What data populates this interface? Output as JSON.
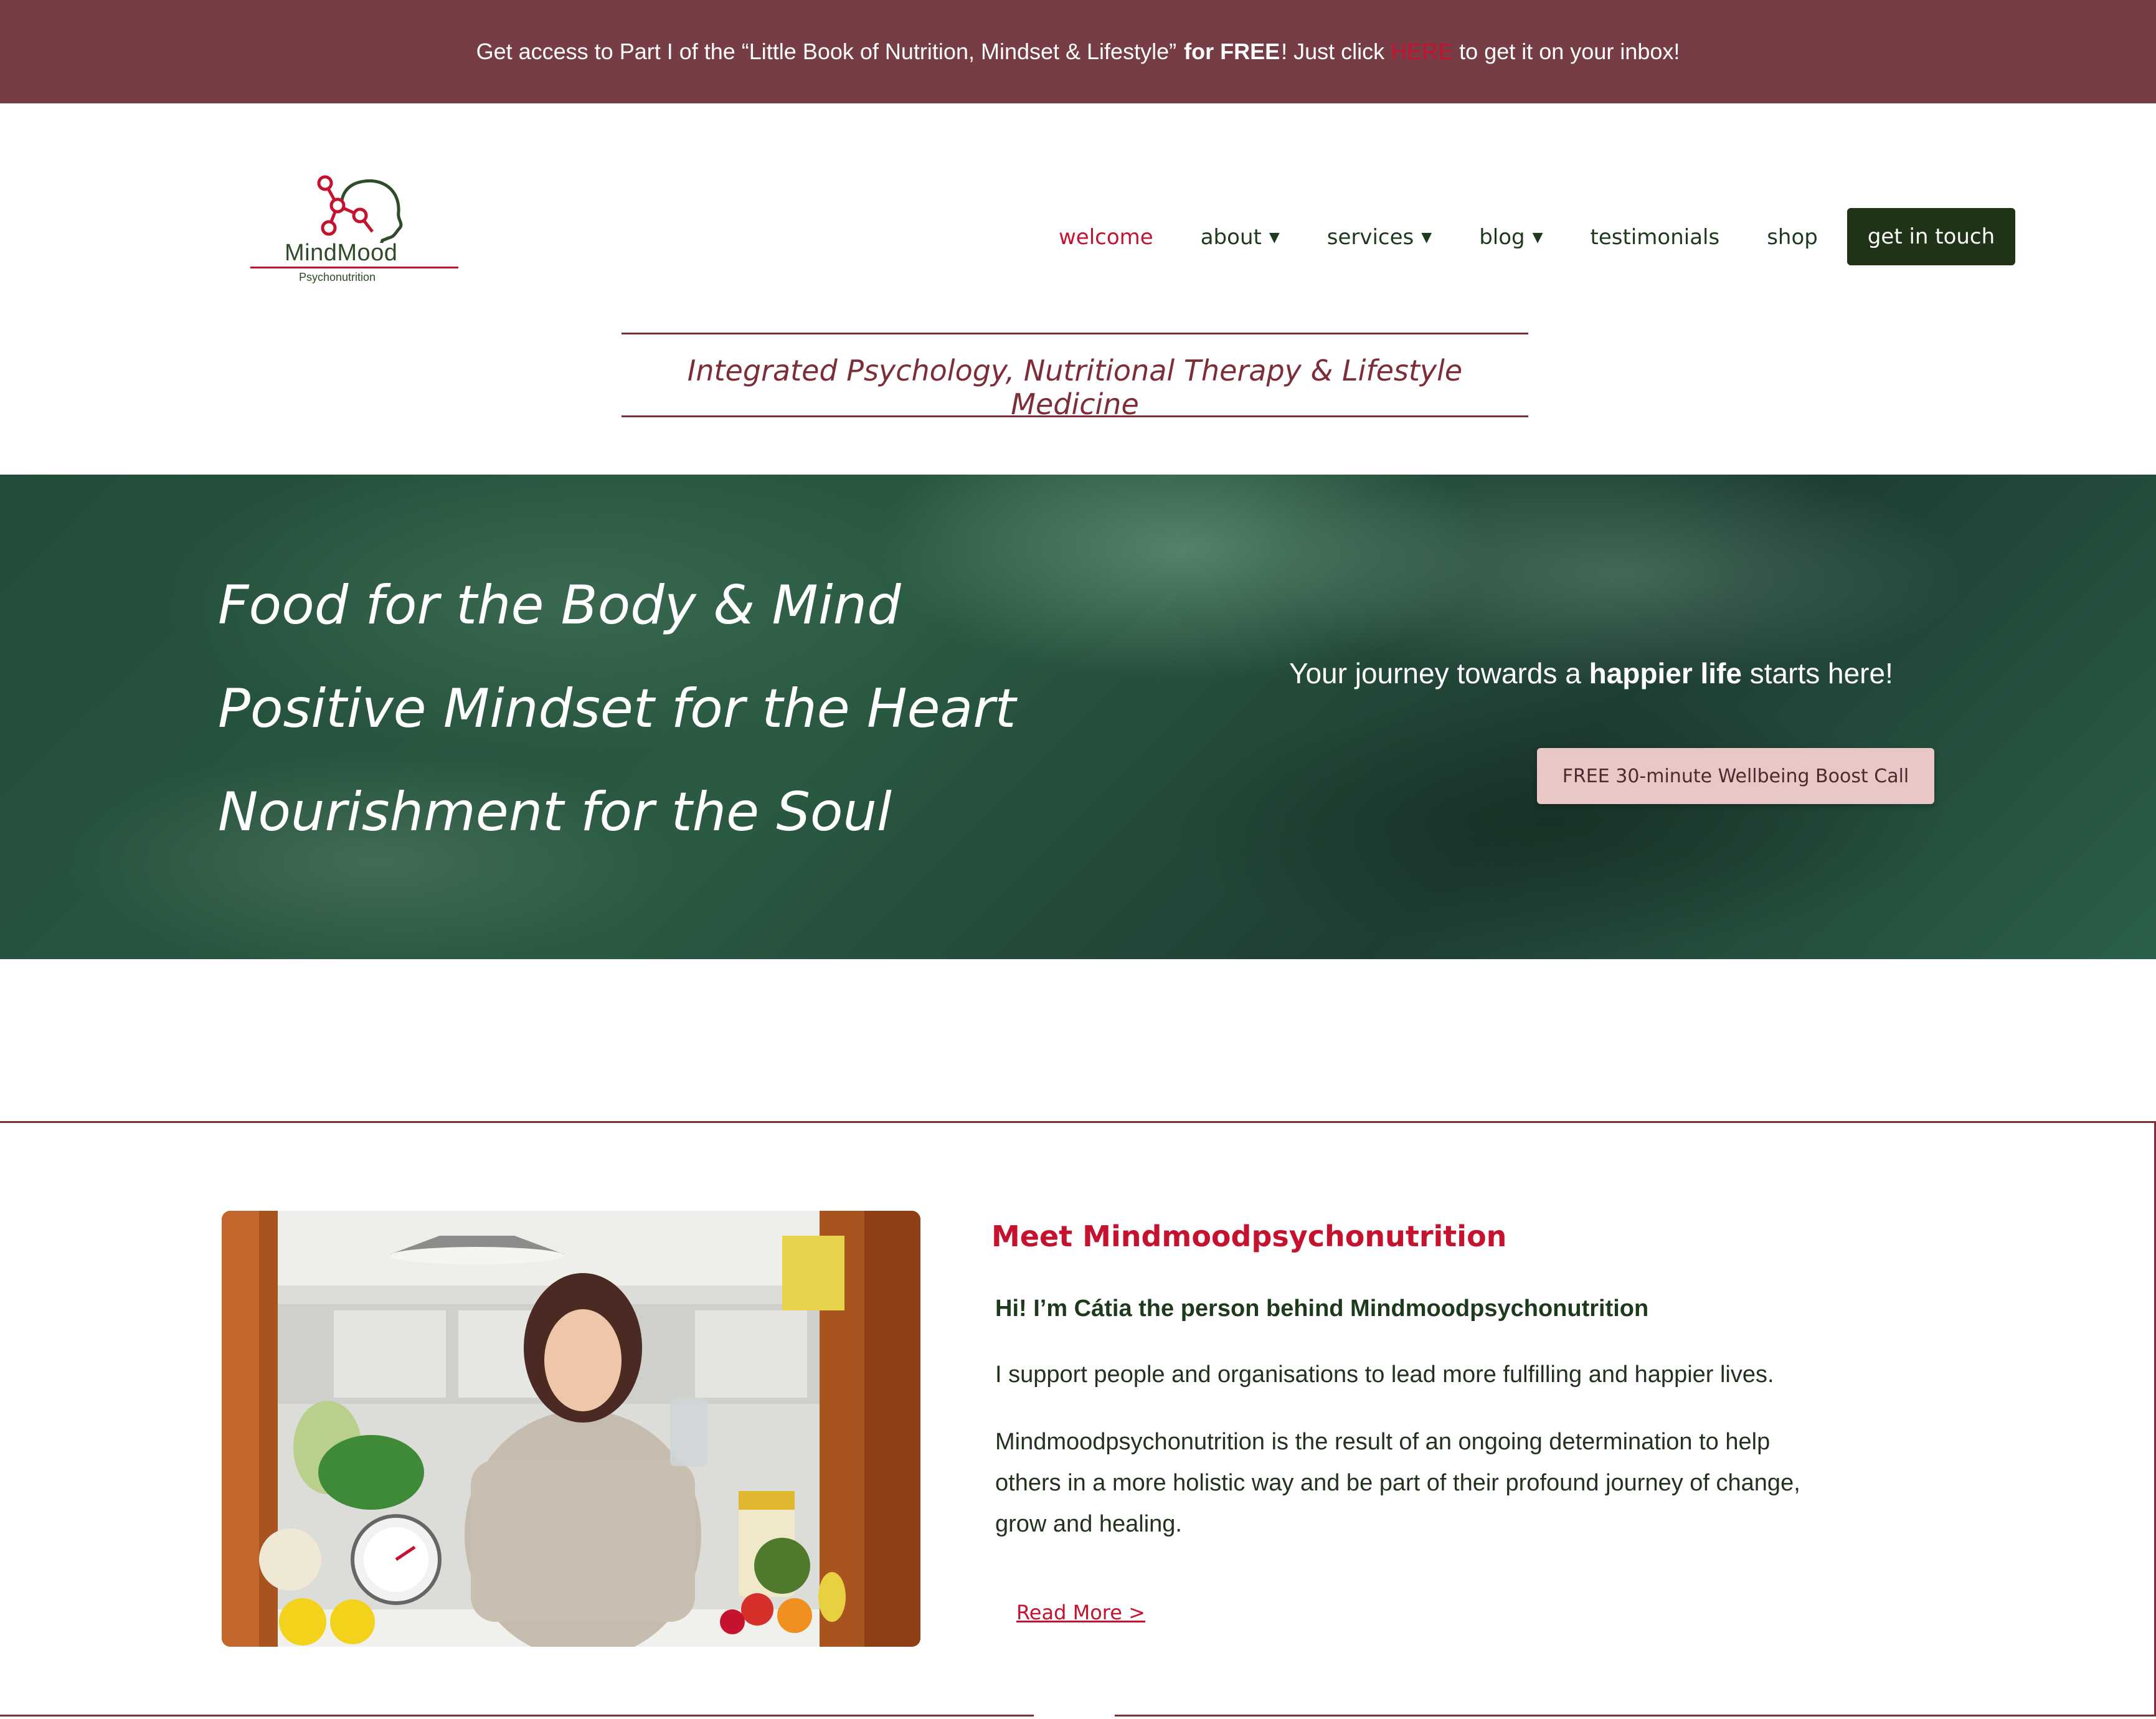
{
  "announcement": {
    "pre": "Get access to Part I of the “Little Book of Nutrition, Mindset & Lifestyle” ",
    "bold": "for FREE",
    "mid": "! Just click",
    "link": "HERE",
    "post": "to get it on your inbox!"
  },
  "logo": {
    "brand": "MindMood",
    "tag": "Psychonutrition"
  },
  "nav": {
    "items": [
      {
        "label": "welcome",
        "chevron": false
      },
      {
        "label": "about",
        "chevron": true
      },
      {
        "label": "services",
        "chevron": true
      },
      {
        "label": "blog",
        "chevron": true
      },
      {
        "label": "testimonials",
        "chevron": false
      },
      {
        "label": "shop",
        "chevron": false
      }
    ],
    "cta": "get in touch"
  },
  "tagline": "Integrated Psychology, Nutritional Therapy & Lifestyle Medicine",
  "hero": {
    "lines": [
      "Food for the Body & Mind",
      "Positive Mindset for the Heart",
      "Nourishment for the Soul"
    ],
    "sub_pre": "Your journey towards a ",
    "sub_bold": "happier life",
    "sub_post": " starts here!",
    "button": "FREE 30-minute Wellbeing Boost Call"
  },
  "about": {
    "title": "Meet Mindmoodpsychonutrition",
    "hi": "Hi! I’m Cátia the person behind Mindmoodpsychonutrition",
    "p1": "I support people and organisations to lead more fulfilling and happier lives.",
    "p2": "Mindmoodpsychonutrition is the result of an ongoing determination to help others in a more holistic way and be part of their profound journey of change, grow and healing.",
    "read_more": "Read More >"
  },
  "colors": {
    "brand_maroon": "#763d45",
    "accent_red": "#c4122f",
    "dark_green": "#1f3317",
    "pink_button": "#e9c7c7"
  }
}
